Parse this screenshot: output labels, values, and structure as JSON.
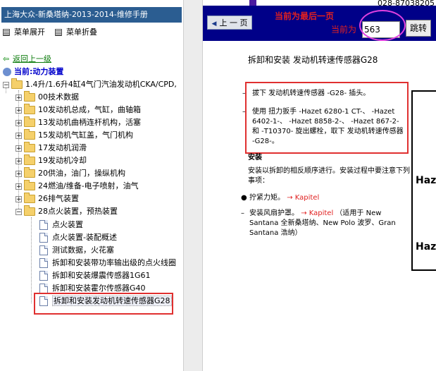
{
  "left_panel": {
    "manual_title": "上海大众-新桑塔纳-2013-2014-维修手册",
    "expand_menu": "菜单展开",
    "collapse_menu": "菜单折叠",
    "back_link": "返回上一级",
    "current_node": "当前:动力装置",
    "tree": {
      "root": "1.4升/1.6升4缸4气门汽油发动机CKA/CPD,",
      "folders": [
        "00技术数据",
        "10发动机总成，气缸，曲轴箱",
        "13发动机曲柄连杆机构，活塞",
        "15发动机气缸盖，气门机构",
        "17发动机润滑",
        "19发动机冷却",
        "20供油，油门，操纵机构",
        "24燃油/维备-电子喷射，油气",
        "26排气装置",
        "28点火装置，预热装置"
      ],
      "docs": [
        "点火装置",
        "点火装置-装配概述",
        "测试数据，火花塞",
        "拆卸和安装带功率输出级的点火线圈",
        "拆卸和安装爆震传感器1G61",
        "拆卸和安装霍尔传感器G40",
        "拆卸和安装发动机转速传感器G28"
      ],
      "selected_index": 6
    }
  },
  "toolbar": {
    "prev_page": "上 一 页",
    "last_page_note": "当前为最后一页",
    "current_page_label": "当前为",
    "page_value": "563",
    "go_button": "跳转",
    "phone_text": "028-87038205"
  },
  "document": {
    "title": "拆卸和安装 发动机转速传感器G28",
    "steps": [
      "拔下 发动机转速传感器 -G28- 插头。",
      "使用 扭力扳手 -Hazet 6280-1 CT-、 -Hazet 6402-1-、 -Hazet 8858-2-、 -Hazet 867-2- 和 -T10370- 旋出螺栓，取下 发动机转速传感器 -G28-。"
    ],
    "install_heading": "安装",
    "install_text": "安装以拆卸的相反顺序进行。安装过程中要注意下列事项：",
    "bullet_1": "拧紧力矩。",
    "bullet_1_link": "→ Kapitel",
    "bullet_2a": "安装风扇护罩。",
    "bullet_2_link": "→ Kapitel",
    "bullet_2b": "（适用于 New Santana 全新桑塔纳、New Polo 波罗、Gran Santana 浩纳）",
    "tool_label": "Haz"
  },
  "colors": {
    "title_bar": "#2b5d91",
    "toolbar_bg": "#000088",
    "highlight_red": "#e03030",
    "magenta_ring": "#e040e0",
    "link_green": "#0a7a0a"
  }
}
